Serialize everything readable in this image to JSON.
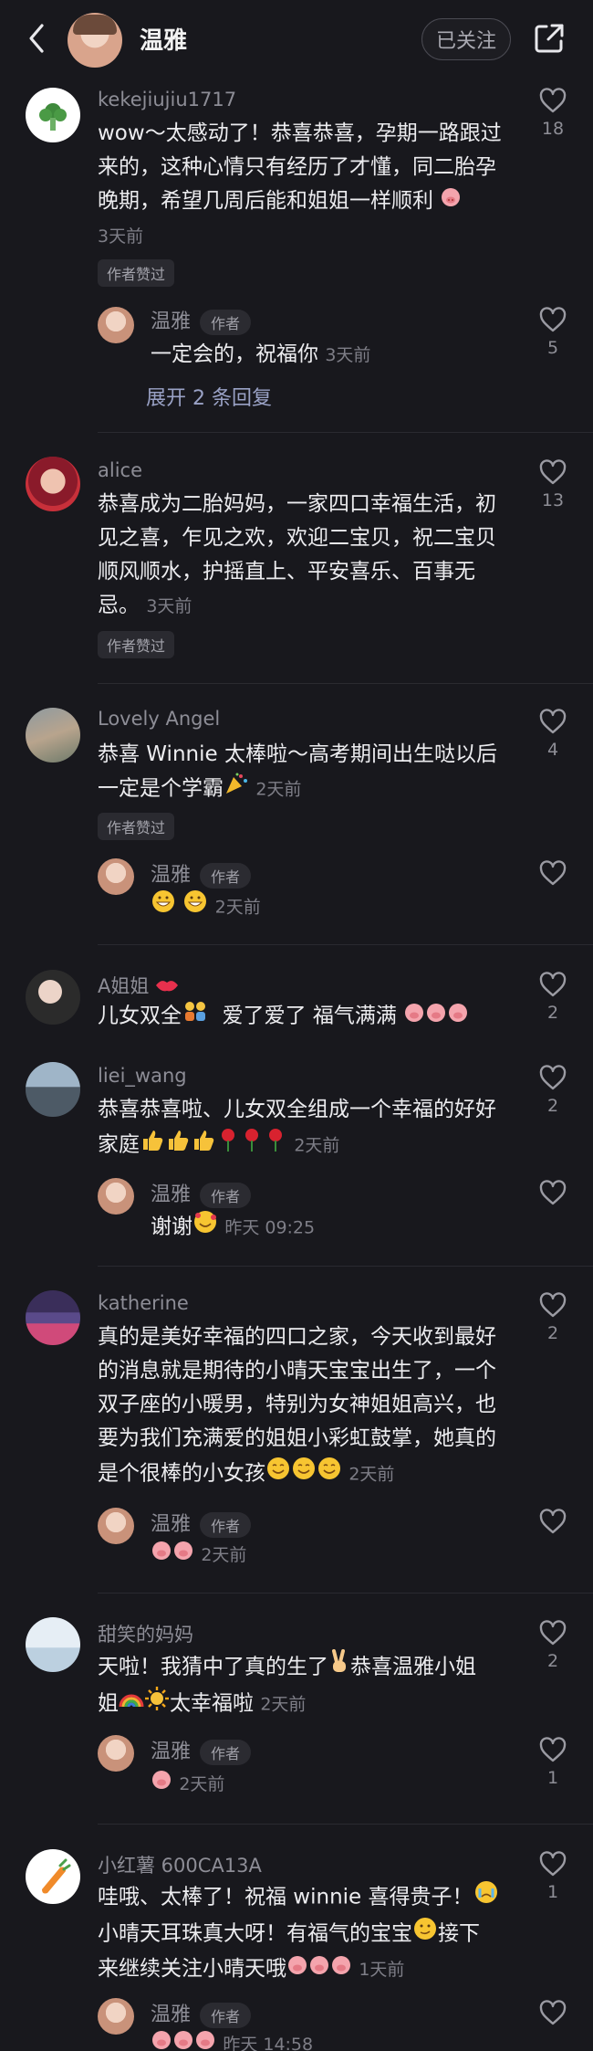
{
  "header": {
    "name": "温雅",
    "follow_label": "已关注"
  },
  "colors": {
    "background": "#18181d",
    "text": "#ececef",
    "muted": "#8d8d96",
    "link": "#9aa2c6"
  },
  "comments": [
    {
      "user": "kekejiujiu1717",
      "text_lines": [
        "wow～太感动了！恭喜恭喜，孕期一路跟过",
        "来的，这种心情只有经历了才懂，同二胎孕",
        "晚期，希望几周后能和姐姐一样顺利"
      ],
      "time": "3天前",
      "badge": "作者赞过",
      "likes": "18",
      "reply": {
        "user": "温雅",
        "tag": "作者",
        "text": "一定会的，祝福你",
        "time": "3天前",
        "likes": "5"
      },
      "expand": "展开 2 条回复"
    },
    {
      "user": "alice",
      "text_lines": [
        "恭喜成为二胎妈妈，一家四口幸福生活，初",
        "见之喜，乍见之欢，欢迎二宝贝，祝二宝贝",
        "顺风顺水，护摇直上、平安喜乐、百事无",
        "忌。"
      ],
      "time": "3天前",
      "badge": "作者赞过",
      "likes": "13"
    },
    {
      "user": "Lovely Angel",
      "text_lines": [
        "恭喜 Winnie 太棒啦～高考期间出生哒以后",
        "一定是个学霸"
      ],
      "time": "2天前",
      "badge": "作者赞过",
      "likes": "4",
      "reply": {
        "user": "温雅",
        "tag": "作者",
        "time": "2天前"
      }
    },
    {
      "user": "A姐姐",
      "text_lines": [
        "儿女双全",
        "爱了爱了  福气满满"
      ],
      "likes": "2"
    },
    {
      "user": "liei_wang",
      "text_lines": [
        "恭喜恭喜啦、儿女双全组成一个幸福的好好",
        "家庭"
      ],
      "time": "2天前",
      "likes": "2",
      "reply": {
        "user": "温雅",
        "tag": "作者",
        "text": "谢谢",
        "time": "昨天 09:25"
      }
    },
    {
      "user": "katherine",
      "text_lines": [
        "真的是美好幸福的四口之家，今天收到最好",
        "的消息就是期待的小晴天宝宝出生了，一个",
        "双子座的小暖男，特别为女神姐姐高兴，也",
        "要为我们充满爱的姐姐小彩虹鼓掌，她真的",
        "是个很棒的小女孩"
      ],
      "time": "2天前",
      "likes": "2",
      "reply": {
        "user": "温雅",
        "tag": "作者",
        "time": "2天前"
      }
    },
    {
      "user": "甜笑的妈妈",
      "text_lines": [
        "天啦！我猜中了真的生了",
        "恭喜温雅小姐",
        "姐",
        "太幸福啦"
      ],
      "time": "2天前",
      "likes": "2",
      "reply": {
        "user": "温雅",
        "tag": "作者",
        "time": "2天前",
        "likes": "1"
      }
    },
    {
      "user": "小红薯 600CA13A",
      "text_lines": [
        "哇哦、太棒了！祝福 winnie 喜得贵子！",
        "小晴天耳珠真大呀！有福气的宝宝",
        "接下",
        "来继续关注小晴天哦"
      ],
      "time": "1天前",
      "likes": "1",
      "reply": {
        "user": "温雅",
        "tag": "作者",
        "time": "昨天 14:58"
      }
    }
  ]
}
